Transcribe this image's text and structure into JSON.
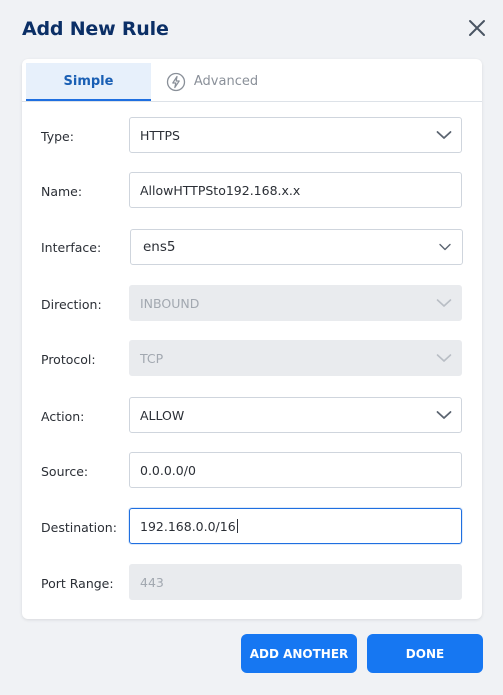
{
  "dialog": {
    "title": "Add New Rule"
  },
  "tabs": [
    {
      "label": "Simple",
      "active": true
    },
    {
      "label": "Advanced",
      "active": false,
      "icon": "lightning-icon"
    }
  ],
  "form": {
    "type": {
      "label": "Type:",
      "value": "HTTPS"
    },
    "name": {
      "label": "Name:",
      "value": "AllowHTTPSto192.168.x.x"
    },
    "interface": {
      "label": "Interface:",
      "value": "ens5"
    },
    "direction": {
      "label": "Direction:",
      "value": "INBOUND"
    },
    "protocol": {
      "label": "Protocol:",
      "value": "TCP"
    },
    "action": {
      "label": "Action:",
      "value": "ALLOW"
    },
    "source": {
      "label": "Source:",
      "value": "0.0.0.0/0"
    },
    "destination": {
      "label": "Destination:",
      "value": "192.168.0.0/16"
    },
    "port_range": {
      "label": "Port Range:",
      "value": "443"
    }
  },
  "buttons": {
    "add_another": "ADD ANOTHER",
    "done": "DONE"
  },
  "colors": {
    "accent": "#1677f2",
    "title": "#0b2f66",
    "background": "#f0f2f5"
  }
}
